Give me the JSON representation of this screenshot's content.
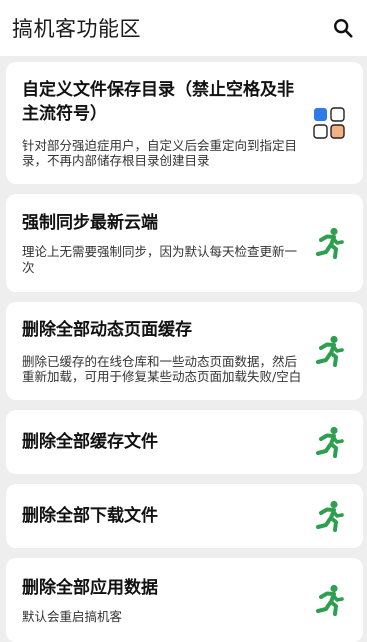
{
  "header": {
    "title": "搞机客功能区",
    "search_icon": "search-icon"
  },
  "items": [
    {
      "title": "自定义文件保存目录（禁止空格及非主流符号）",
      "desc": "针对部分强迫症用户，自定义后会重定向到指定目录，不再内部储存根目录创建目录",
      "icon": "grid-apps-icon"
    },
    {
      "title": "强制同步最新云端",
      "desc": "理论上无需要强制同步，因为默认每天检查更新一次",
      "icon": "running-person-icon"
    },
    {
      "title": "删除全部动态页面缓存",
      "desc": "删除已缓存的在线仓库和一些动态页面数据，然后重新加载，可用于修复某些动态页面加载失败/空白",
      "icon": "running-person-icon"
    },
    {
      "title": "删除全部缓存文件",
      "icon": "running-person-icon"
    },
    {
      "title": "删除全部下载文件",
      "icon": "running-person-icon"
    },
    {
      "title": "删除全部应用数据",
      "desc": "默认会重启搞机客",
      "icon": "running-person-icon"
    }
  ],
  "colors": {
    "run_icon": "#2e9e4f",
    "grid_blue": "#2d7be5",
    "grid_orange": "#f4b183",
    "background": "#eeeeee"
  }
}
